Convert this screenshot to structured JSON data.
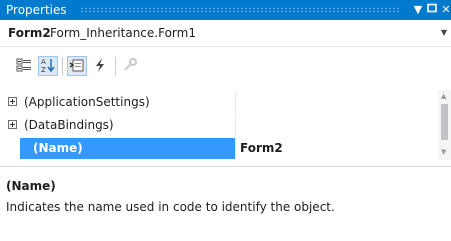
{
  "window": {
    "title": "Properties",
    "pin_icon": "dropdown-arrow-icon",
    "close_icon": "close-icon",
    "accent": "#007acc"
  },
  "object_selector": {
    "name": "Form2",
    "type": "Form_Inheritance.Form1"
  },
  "toolbar": {
    "buttons": [
      {
        "icon": "categorized-icon",
        "selected": false
      },
      {
        "icon": "alphabetical-icon",
        "selected": true
      },
      {
        "icon": "properties-icon",
        "selected": true
      },
      {
        "icon": "events-icon",
        "selected": false
      },
      {
        "icon": "property-pages-icon",
        "selected": false
      }
    ]
  },
  "grid": {
    "rows": [
      {
        "name": "(ApplicationSettings)",
        "value": "",
        "expandable": true,
        "selected": false
      },
      {
        "name": "(DataBindings)",
        "value": "",
        "expandable": true,
        "selected": false
      },
      {
        "name": "(Name)",
        "value": "Form2",
        "expandable": false,
        "selected": true
      }
    ],
    "selection_color": "#3399ff"
  },
  "description": {
    "title": "(Name)",
    "text": "Indicates the name used in code to identify the object."
  }
}
